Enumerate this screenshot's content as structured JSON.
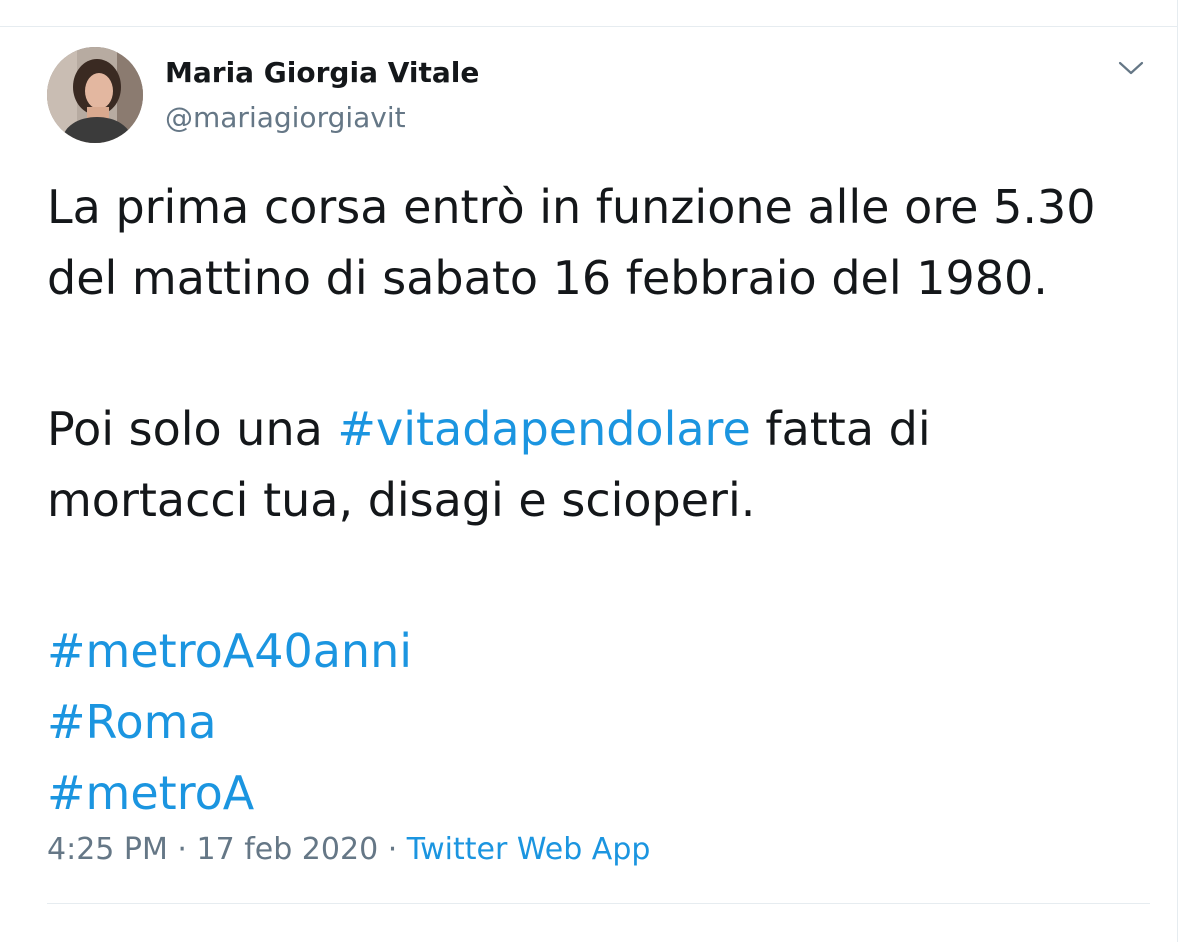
{
  "tweet": {
    "author": {
      "display_name": "Maria Giorgia Vitale",
      "handle": "@mariagiorgiavit",
      "avatar_icon": "user-avatar-photo"
    },
    "menu_icon": "chevron-down-icon",
    "text": {
      "line1": "La prima corsa entrò in funzione alle ore 5.30",
      "line2": "del mattino di sabato 16 febbraio del 1980.",
      "line3_before": "Poi solo una ",
      "line3_hashtag": "#vitadapendolare",
      "line3_after": " fatta di",
      "line4": "mortacci tua, disagi e scioperi.",
      "hashtags": [
        "#metroA40anni",
        "#Roma",
        "#metroA"
      ]
    },
    "meta": {
      "time": "4:25 PM",
      "separator": " · ",
      "date": "17 feb 2020",
      "source": "Twitter Web App"
    }
  },
  "colors": {
    "text": "#14171a",
    "secondary": "#657786",
    "link": "#1b95e0",
    "border": "#e6ecf0"
  }
}
